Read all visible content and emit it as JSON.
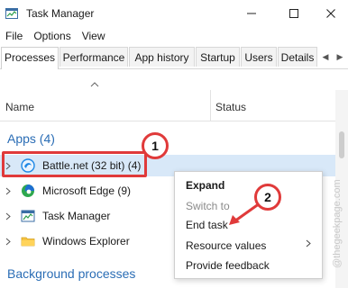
{
  "window": {
    "title": "Task Manager",
    "icon": "task-manager-app-icon",
    "controls": {
      "minimize_icon": "minimize-icon",
      "maximize_icon": "maximize-icon",
      "close_icon": "close-icon"
    }
  },
  "menu": {
    "items": [
      "File",
      "Options",
      "View"
    ]
  },
  "tabs": {
    "items": [
      "Processes",
      "Performance",
      "App history",
      "Startup",
      "Users",
      "Details"
    ],
    "active": "Processes",
    "scroll_left_icon": "chevron-left-icon",
    "scroll_right_icon": "chevron-right-icon"
  },
  "columns": {
    "name": "Name",
    "status": "Status"
  },
  "groups": {
    "apps": "Apps (4)",
    "background": "Background processes"
  },
  "processes": [
    {
      "name": "Battle.net (32 bit) (4)",
      "icon": "battle-net-icon",
      "selected": true
    },
    {
      "name": "Microsoft Edge (9)",
      "icon": "edge-icon",
      "selected": false
    },
    {
      "name": "Task Manager",
      "icon": "task-manager-icon",
      "selected": false
    },
    {
      "name": "Windows Explorer",
      "icon": "folder-icon",
      "selected": false
    }
  ],
  "context_menu": {
    "expand": "Expand",
    "switch_to": "Switch to",
    "end_task": "End task",
    "resource_values": "Resource values",
    "provide_feedback": "Provide feedback",
    "submenu_icon": "chevron-right-icon"
  },
  "annotations": {
    "badge_1": "1",
    "badge_2": "2"
  },
  "watermark": "@thegeekpage.com",
  "colors": {
    "accent": "#2a6db5",
    "annotation_red": "#e03a3a",
    "selection": "#d8e8f8"
  }
}
